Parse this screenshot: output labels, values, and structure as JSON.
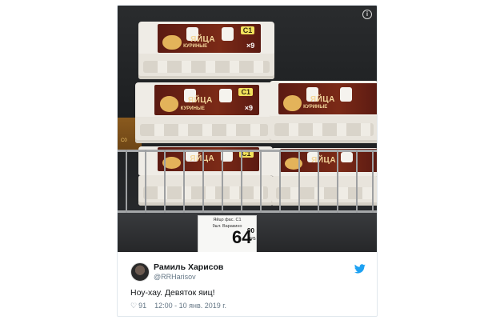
{
  "photo": {
    "carton_label": {
      "title": "ЯЙЦА",
      "subtitle": "КУРИНЫЕ",
      "grade": "С1",
      "count": "×9"
    },
    "side_box_text": "С0",
    "price_tag": {
      "product": "Яйцо фас. С1",
      "product_line2": "9шт. Варакино",
      "rubles": "64",
      "kopecks": "90",
      "currency": "РУБ"
    }
  },
  "tweet": {
    "author_name": "Рамиль Харисов",
    "author_handle": "@RRHarisov",
    "text": "Ноу-хау. Девяток яиц!",
    "likes": "91",
    "timestamp": "12:00 - 10 янв. 2019 г."
  },
  "colors": {
    "label_brown": "#6b2215",
    "label_gold": "#f4d79b",
    "twitter_blue": "#1da1f2",
    "muted_text": "#657786"
  },
  "icons": {
    "info": "info-icon",
    "twitter": "twitter-bird-icon",
    "like": "heart-icon"
  }
}
